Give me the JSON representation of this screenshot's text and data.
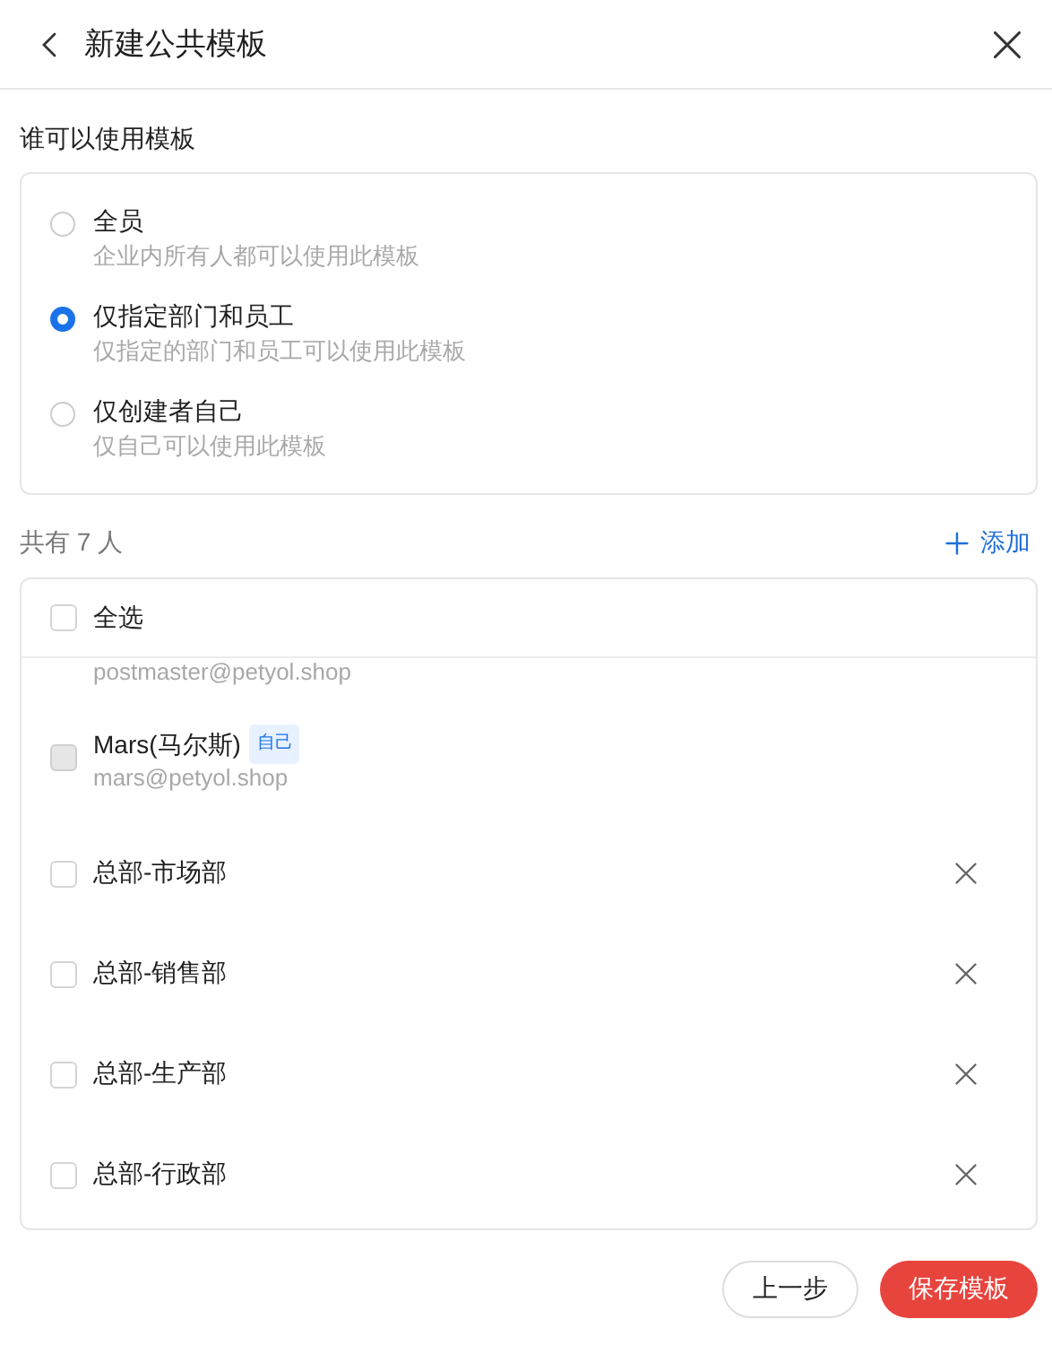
{
  "header": {
    "title": "新建公共模板"
  },
  "scope": {
    "title": "谁可以使用模板",
    "options": [
      {
        "label": "全员",
        "description": "企业内所有人都可以使用此模板",
        "selected": false
      },
      {
        "label": "仅指定部门和员工",
        "description": "仅指定的部门和员工可以使用此模板",
        "selected": true
      },
      {
        "label": "仅创建者自己",
        "description": "仅自己可以使用此模板",
        "selected": false
      }
    ]
  },
  "members": {
    "count_label": "共有 7 人",
    "add_label": "添加",
    "select_all": {
      "label": "全选",
      "checked": false
    },
    "partial_email": "postmaster@petyol.shop",
    "items": [
      {
        "kind": "person",
        "name": "Mars(马尔斯)",
        "tag": "自己",
        "email": "mars@petyol.shop",
        "checked": false,
        "disabled": true
      },
      {
        "kind": "department",
        "name": "总部-市场部",
        "checked": false,
        "disabled": false
      },
      {
        "kind": "department",
        "name": "总部-销售部",
        "checked": false,
        "disabled": false
      },
      {
        "kind": "department",
        "name": "总部-生产部",
        "checked": false,
        "disabled": false
      },
      {
        "kind": "department",
        "name": "总部-行政部",
        "checked": false,
        "disabled": false
      }
    ]
  },
  "buttons": {
    "back": "上一步",
    "save": "保存模板"
  }
}
